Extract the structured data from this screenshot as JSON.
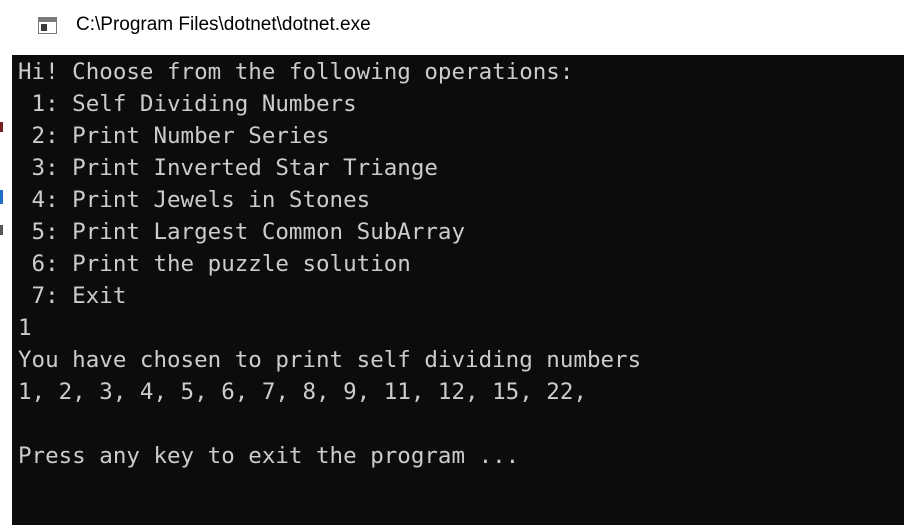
{
  "window": {
    "title": "C:\\Program Files\\dotnet\\dotnet.exe",
    "icon": "console-app-icon"
  },
  "console": {
    "lines": [
      "Hi! Choose from the following operations:",
      " 1: Self Dividing Numbers",
      " 2: Print Number Series",
      " 3: Print Inverted Star Triange",
      " 4: Print Jewels in Stones",
      " 5: Print Largest Common SubArray",
      " 6: Print the puzzle solution",
      " 7: Exit",
      "1",
      "You have chosen to print self dividing numbers",
      "1, 2, 3, 4, 5, 6, 7, 8, 9, 11, 12, 15, 22,",
      "",
      "Press any key to exit the program ..."
    ]
  },
  "colors": {
    "console_background": "#0c0c0c",
    "console_text": "#cccccc",
    "titlebar_background": "#ffffff"
  }
}
